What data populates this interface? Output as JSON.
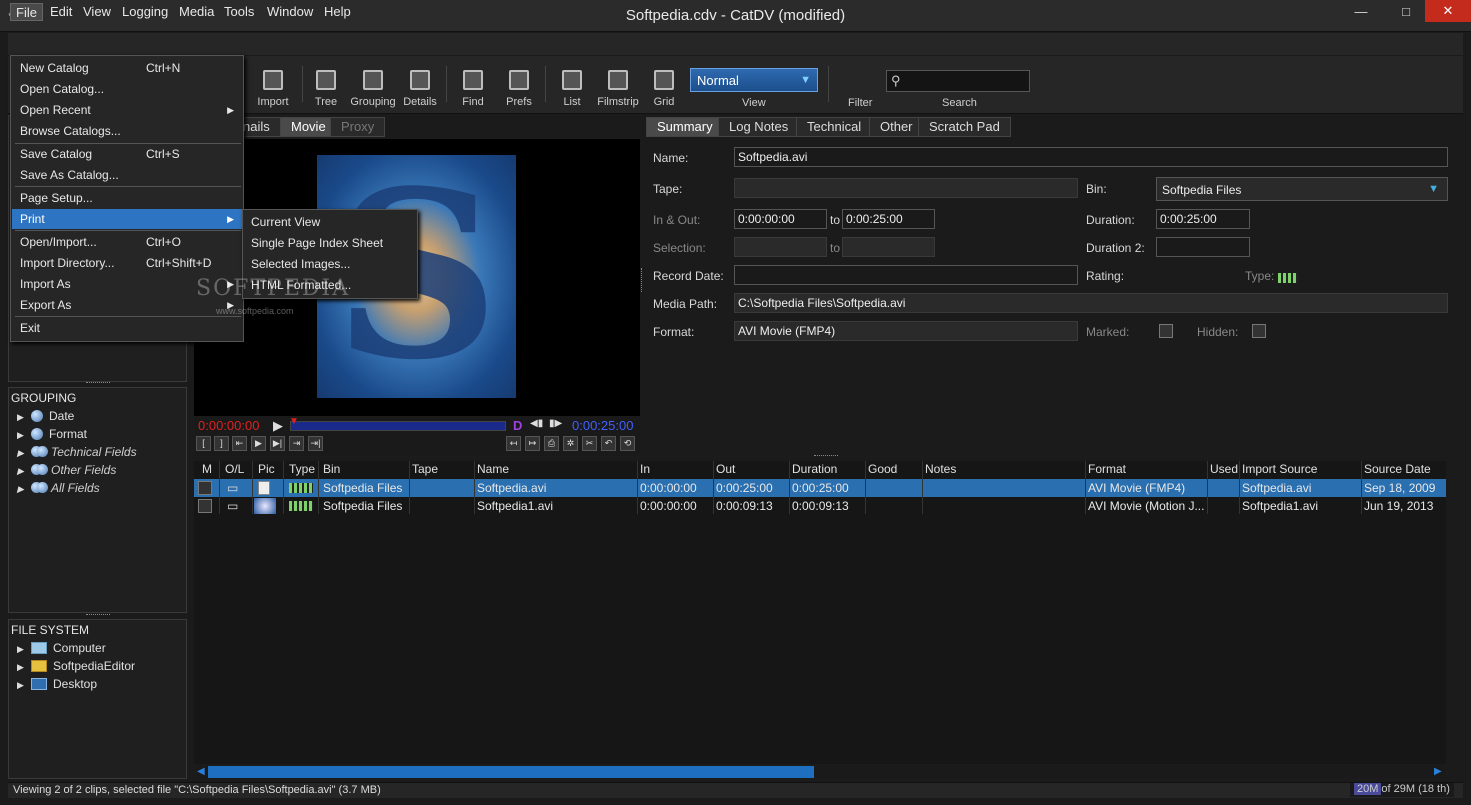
{
  "window": {
    "title": "Softpedia.cdv - CatDV (modified)",
    "minimize": "—",
    "maximize": "□",
    "close": "✕"
  },
  "menubar": [
    "File",
    "Edit",
    "View",
    "Logging",
    "Media",
    "Tools",
    "Window",
    "Help"
  ],
  "toolbar": {
    "import": "Import",
    "tree": "Tree",
    "grouping": "Grouping",
    "details": "Details",
    "find": "Find",
    "prefs": "Prefs",
    "list": "List",
    "filmstrip": "Filmstrip",
    "grid": "Grid",
    "view_label": "View",
    "view_value": "Normal",
    "filter_label": "Filter",
    "search_label": "Search",
    "search_value": ""
  },
  "file_menu": [
    {
      "label": "New Catalog",
      "shortcut": "Ctrl+N"
    },
    {
      "label": "Open Catalog...",
      "shortcut": ""
    },
    {
      "label": "Open Recent",
      "shortcut": "",
      "submenu": true
    },
    {
      "label": "Browse Catalogs...",
      "shortcut": ""
    },
    {
      "label": "Save Catalog",
      "shortcut": "Ctrl+S"
    },
    {
      "label": "Save As Catalog...",
      "shortcut": ""
    },
    {
      "label": "Page Setup...",
      "shortcut": ""
    },
    {
      "label": "Print",
      "shortcut": "",
      "submenu": true
    },
    {
      "label": "Open/Import...",
      "shortcut": "Ctrl+O"
    },
    {
      "label": "Import Directory...",
      "shortcut": "Ctrl+Shift+D"
    },
    {
      "label": "Import As",
      "shortcut": "",
      "submenu": true
    },
    {
      "label": "Export As",
      "shortcut": "",
      "submenu": true
    },
    {
      "label": "Exit",
      "shortcut": ""
    }
  ],
  "print_submenu": [
    "Current View",
    "Single Page Index Sheet",
    "Selected Images...",
    "HTML Formatted..."
  ],
  "watermark": {
    "brand": "SOFTPEDIA",
    "url": "www.softpedia.com"
  },
  "grouping": {
    "title": "GROUPING",
    "items": [
      "Date",
      "Format",
      "Technical Fields",
      "Other Fields",
      "All Fields"
    ]
  },
  "filesystem": {
    "title": "FILE SYSTEM",
    "items": [
      "Computer",
      "SoftpediaEditor",
      "Desktop"
    ]
  },
  "preview_tabs": [
    "nails",
    "Movie",
    "Proxy"
  ],
  "transport": {
    "tc_in": "0:00:00:00",
    "tc_out": "0:00:25:00",
    "d_marker": "D"
  },
  "detail_tabs": [
    "Summary",
    "Log Notes",
    "Technical",
    "Other",
    "Scratch Pad"
  ],
  "summary": {
    "name_label": "Name:",
    "name": "Softpedia.avi",
    "tape_label": "Tape:",
    "tape": "",
    "bin_label": "Bin:",
    "bin": "Softpedia Files",
    "inout_label": "In & Out:",
    "in": "0:00:00:00",
    "to": "to",
    "out": "0:00:25:00",
    "duration_label": "Duration:",
    "duration": "0:00:25:00",
    "selection_label": "Selection:",
    "duration2_label": "Duration 2:",
    "recdate_label": "Record Date:",
    "rating_label": "Rating:",
    "type_label": "Type:",
    "mediapath_label": "Media Path:",
    "mediapath": "C:\\Softpedia Files\\Softpedia.avi",
    "format_label": "Format:",
    "format": "AVI Movie (FMP4)",
    "marked_label": "Marked:",
    "hidden_label": "Hidden:"
  },
  "table": {
    "headers": [
      "M",
      "O/L",
      "Pic",
      "Type",
      "Bin",
      "Tape",
      "Name",
      "In",
      "Out",
      "Duration",
      "Good",
      "Notes",
      "Format",
      "Used",
      "Import Source",
      "Source Date"
    ],
    "rows": [
      {
        "bin": "Softpedia Files",
        "tape": "",
        "name": "Softpedia.avi",
        "in": "0:00:00:00",
        "out": "0:00:25:00",
        "duration": "0:00:25:00",
        "good": "",
        "notes": "",
        "format": "AVI Movie (FMP4)",
        "used": "",
        "source": "Softpedia.avi",
        "date": "Sep 18, 2009"
      },
      {
        "bin": "Softpedia Files",
        "tape": "",
        "name": "Softpedia1.avi",
        "in": "0:00:00:00",
        "out": "0:00:09:13",
        "duration": "0:00:09:13",
        "good": "",
        "notes": "",
        "format": "AVI Movie (Motion J...",
        "used": "",
        "source": "Softpedia1.avi",
        "date": "Jun 19, 2013"
      }
    ]
  },
  "status": {
    "text": "Viewing 2 of 2 clips, selected file \"C:\\Softpedia Files\\Softpedia.avi\" (3.7 MB)",
    "mem_used": "20M",
    "mem_rest": "of 29M (18 th)"
  },
  "colors": {
    "accent": "#2d74c2",
    "selection": "#2a6fb0",
    "timecode_in": "#e02020",
    "timecode_out": "#4060ff"
  }
}
